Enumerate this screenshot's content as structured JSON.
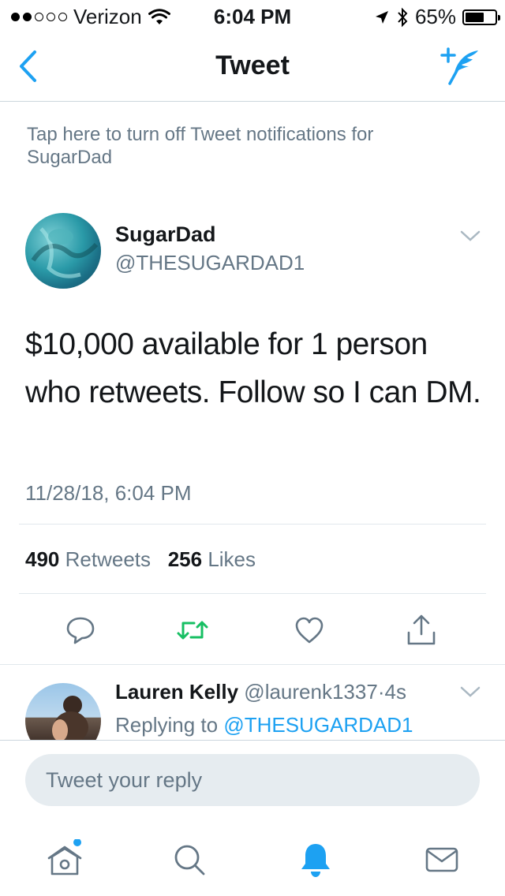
{
  "status_bar": {
    "signal_dots_filled": 2,
    "signal_dots_total": 5,
    "carrier": "Verizon",
    "time": "6:04 PM",
    "battery": "65%",
    "battery_level": 0.65
  },
  "nav": {
    "title": "Tweet"
  },
  "notify_banner": {
    "text": "Tap here to turn off Tweet notifications for SugarDad"
  },
  "tweet": {
    "author_name": "SugarDad",
    "author_handle": "@THESUGARDAD1",
    "text": "$10,000 available for 1 person who retweets. Follow so I can DM.",
    "timestamp": "11/28/18, 6:04 PM",
    "retweet_count": "490",
    "retweet_label": "Retweets",
    "like_count": "256",
    "like_label": "Likes"
  },
  "reply": {
    "name": "Lauren Kelly",
    "handle": "@laurenk1337",
    "separator": "·",
    "time": "4s",
    "replying_label": "Replying to",
    "replying_handle": "@THESUGARDAD1"
  },
  "compose": {
    "placeholder": "Tweet your reply"
  },
  "colors": {
    "accent": "#1da1f2",
    "retweet_green": "#17bf63",
    "secondary_text": "#657786",
    "divider": "#e1e8ed"
  },
  "icons": {
    "back": "chevron-left-icon",
    "compose": "compose-tweet-icon",
    "caret": "chevron-down-icon",
    "reply": "reply-icon",
    "retweet": "retweet-icon",
    "like": "heart-icon",
    "share": "share-icon",
    "home": "home-icon",
    "search": "search-icon",
    "notifications": "bell-icon",
    "messages": "mail-icon"
  }
}
